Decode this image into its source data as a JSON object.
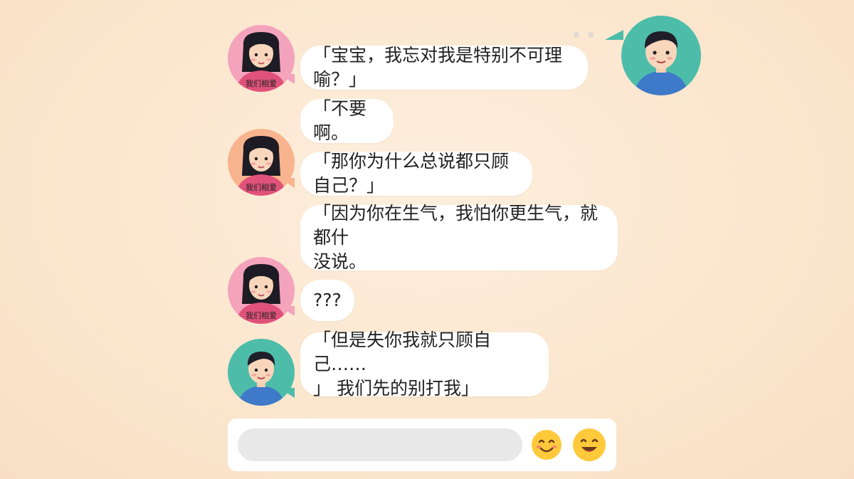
{
  "chat": {
    "messages": [
      {
        "sender": "girl",
        "text": "「宝宝，我忘对我是特别不可理喻？」"
      },
      {
        "sender": "boy",
        "text": "「不要啊。"
      },
      {
        "sender": "girl",
        "text": "「那你为什么总说都只顾自己？」"
      },
      {
        "sender": "boy",
        "text": "「因为你在生气，我怕你更生气，就都什\n没说。"
      },
      {
        "sender": "girl",
        "text": "???"
      },
      {
        "sender": "boy",
        "text": "「但是失你我就只顾自己……\n」 我们先的别打我」"
      }
    ],
    "girl_shirt_text": "我们相爱",
    "colors": {
      "girl_avatar_bg": "#f4a3bc",
      "girl_avatar_bg_alt": "#f8b48e",
      "boy_avatar_bg": "#4dbdaa",
      "girl_shirt": "#e0527a",
      "boy_shirt": "#3f79c9"
    }
  },
  "composer": {
    "input_value": "",
    "emoji_1": "smiley-emoji",
    "emoji_2": "grinning-emoji"
  }
}
